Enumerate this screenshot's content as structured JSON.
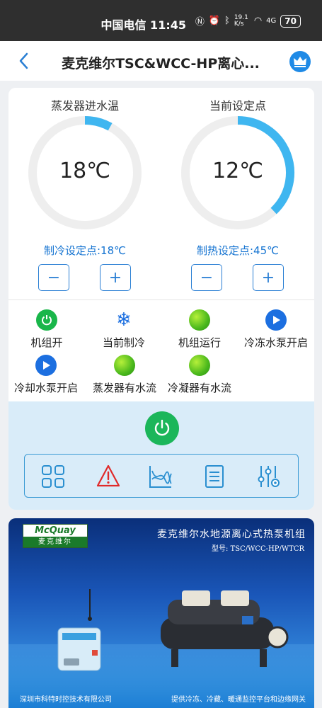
{
  "status_bar": {
    "carrier_time": "中国电信 11:45",
    "speed": "19.1 K/s",
    "signal": "4G",
    "battery": "70"
  },
  "header": {
    "title": "麦克维尔TSC&WCC-HP离心...",
    "back_icon": "chevron-left-icon",
    "crown_icon": "crown-icon"
  },
  "gauges": {
    "left": {
      "title": "蒸发器进水温",
      "value": "18℃",
      "fraction": 0.08
    },
    "right": {
      "title": "当前设定点",
      "value": "12℃",
      "fraction": 0.38
    }
  },
  "setpoints": {
    "cooling": "制冷设定点:18℃",
    "heating": "制热设定点:45℃",
    "minus": "−",
    "plus": "+"
  },
  "statuses": [
    {
      "label": "机组开",
      "icon": "power-icon"
    },
    {
      "label": "当前制冷",
      "icon": "snowflake-icon"
    },
    {
      "label": "机组运行",
      "icon": "green-indicator-icon"
    },
    {
      "label": "冷冻水泵开启",
      "icon": "play-icon"
    },
    {
      "label": "冷却水泵开启",
      "icon": "play-icon"
    },
    {
      "label": "蒸发器有水流",
      "icon": "green-indicator-icon"
    },
    {
      "label": "冷凝器有水流",
      "icon": "green-indicator-icon"
    }
  ],
  "colors": {
    "accent": "#1f8ae6",
    "gauge_arc": "#3fb6f0",
    "setpoint_text": "#1473d1",
    "power_green": "#1bb65a",
    "alarm_red": "#e02a2a"
  },
  "banner": {
    "logo_top": "McQuay",
    "logo_bottom": "麦克维尔",
    "title": "麦克维尔水地源离心式热泵机组",
    "model": "型号: TSC/WCC-HP/WTCR",
    "footer_left": "深圳市科特时控技术有限公司",
    "footer_right": "提供冷冻、冷藏、暖通监控平台和边缘网关"
  }
}
